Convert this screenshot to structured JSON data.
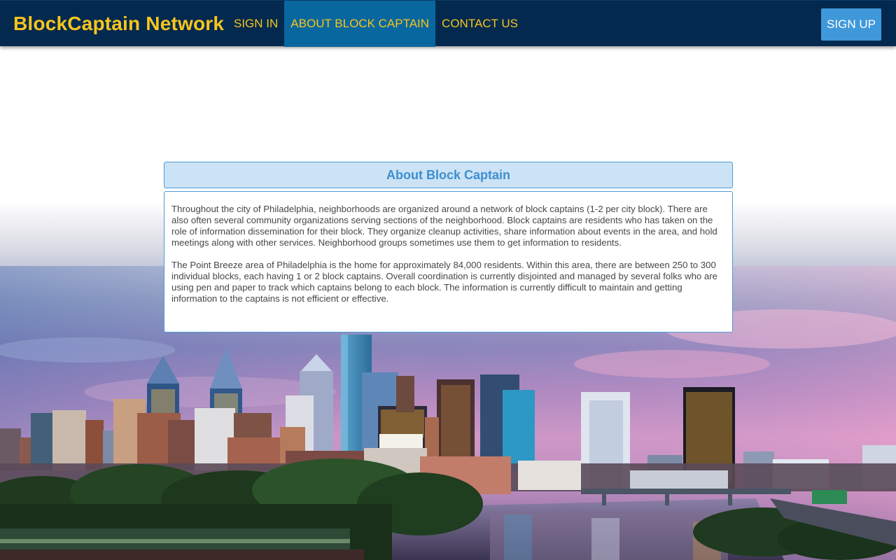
{
  "navbar": {
    "brand": "BlockCaptain Network",
    "links": [
      {
        "label": "SIGN IN",
        "active": false
      },
      {
        "label": "ABOUT BLOCK CAPTAIN",
        "active": true
      },
      {
        "label": "CONTACT US",
        "active": false
      }
    ],
    "signup_label": "SIGN UP"
  },
  "about": {
    "title": "About Block Captain",
    "paragraphs": [
      "Throughout the city of Philadelphia, neighborhoods are organized around a network of block captains (1-2 per city block). There are also often several community organizations serving sections of the neighborhood. Block captains are residents who has taken on the role of information dissemination for their block. They organize cleanup activities, share information about events in the area, and hold meetings along with other services. Neighborhood groups sometimes use them to get information to residents.",
      "The Point Breeze area of Philadelphia is the home for approximately 84,000 residents. Within this area, there are between 250 to 300 individual blocks, each having 1 or 2 block captains. Overall coordination is currently disjointed and managed by several folks who are using pen and paper to track which captains belong to each block. The information is currently difficult to maintain and getting information to the captains is not efficient or effective."
    ]
  },
  "colors": {
    "navbar_bg": "#03294f",
    "brand": "#f8c51c",
    "active_nav_bg": "#09679f",
    "signup_bg": "#3f98d9",
    "panel_header_bg": "#cce3f5",
    "panel_title": "#3d8fd1"
  },
  "background": {
    "image": "philadelphia-skyline-at-dusk"
  }
}
